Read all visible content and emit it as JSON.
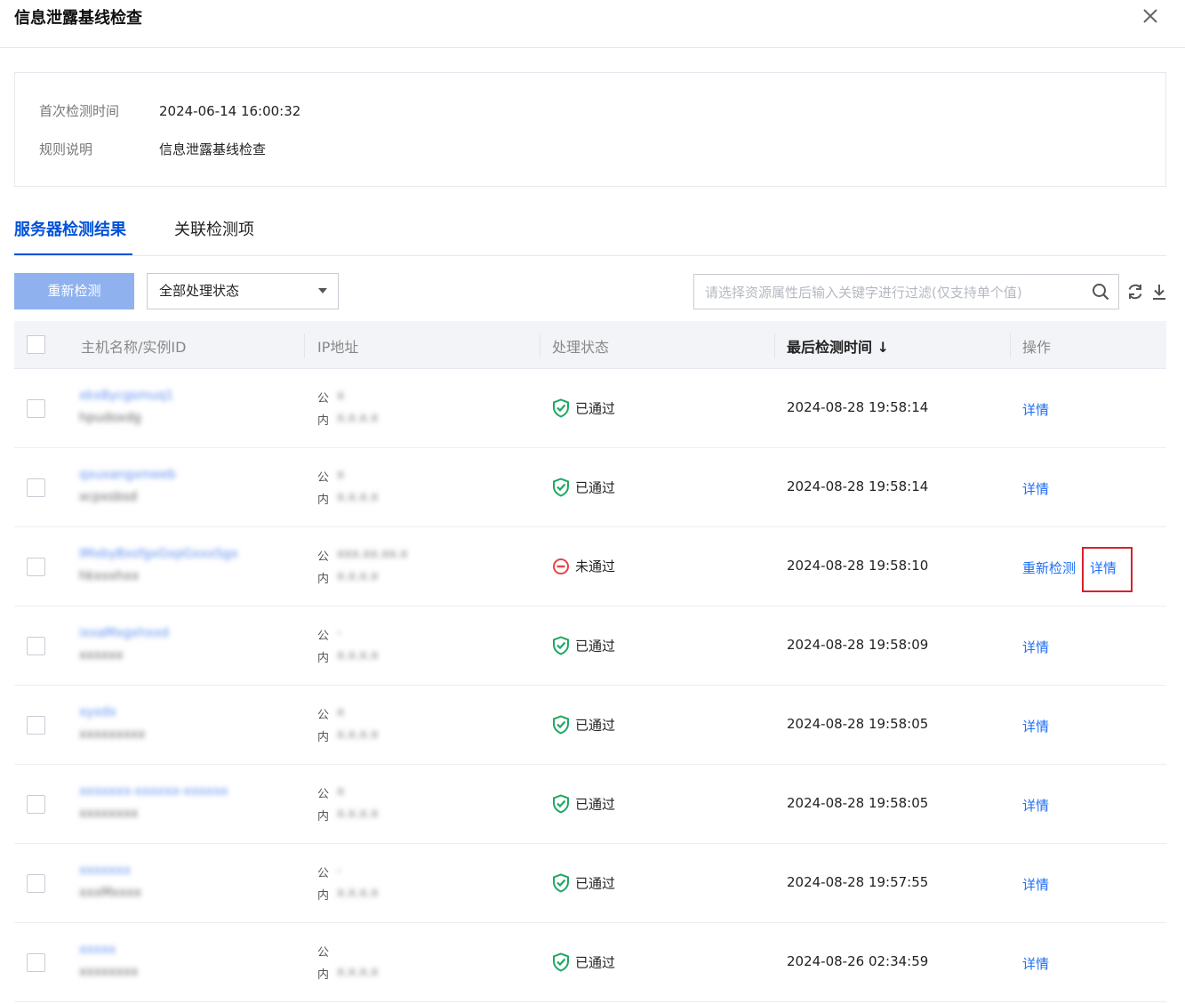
{
  "header": {
    "title": "信息泄露基线检查"
  },
  "info": {
    "first_check_label": "首次检测时间",
    "first_check_value": "2024-06-14 16:00:32",
    "rule_label": "规则说明",
    "rule_value": "信息泄露基线检查"
  },
  "tabs": [
    {
      "label": "服务器检测结果",
      "active": true
    },
    {
      "label": "关联检测项",
      "active": false
    }
  ],
  "toolbar": {
    "recheck_label": "重新检测",
    "status_select_value": "全部处理状态",
    "search_placeholder": "请选择资源属性后输入关键字进行过滤(仅支持单个值)"
  },
  "table": {
    "columns": {
      "host": "主机名称/实例ID",
      "ip": "IP地址",
      "status": "处理状态",
      "last_check": "最后检测时间",
      "sort_indicator": "↓",
      "actions": "操作"
    },
    "ip_public_label": "公",
    "ip_private_label": "内",
    "rows": [
      {
        "host_name": "xkx8ycgsmuq1",
        "instance_id": "hpudoxdg",
        "public_ip": "x",
        "private_ip": "x.x.x.x",
        "status": "已通过",
        "status_type": "pass",
        "last_check": "2024-08-28 19:58:14",
        "actions": [
          "详情"
        ]
      },
      {
        "host_name": "qxuxangxmeeb",
        "instance_id": "xcpxsbsd",
        "public_ip": "x",
        "private_ip": "x.x.x.x",
        "status": "已通过",
        "status_type": "pass",
        "last_check": "2024-08-28 19:58:14",
        "actions": [
          "详情"
        ]
      },
      {
        "host_name": "IMxbyBxsfgxGxpGxxxSgx",
        "instance_id": "hkxxxhxx",
        "public_ip": "xxx.xx.xx.x",
        "private_ip": "x.x.x.x",
        "status": "未通过",
        "status_type": "fail",
        "last_check": "2024-08-28 19:58:10",
        "actions": [
          "重新检测",
          "详情"
        ]
      },
      {
        "host_name": "ixxaMxgxhxxd",
        "instance_id": "xxxxxx",
        "public_ip": "-",
        "private_ip": "x.x.x.x",
        "status": "已通过",
        "status_type": "pass",
        "last_check": "2024-08-28 19:58:09",
        "actions": [
          "详情"
        ]
      },
      {
        "host_name": "xyxdx",
        "instance_id": "xxxxxxxxx",
        "public_ip": "x",
        "private_ip": "x.x.x.x",
        "status": "已通过",
        "status_type": "pass",
        "last_check": "2024-08-28 19:58:05",
        "actions": [
          "详情"
        ]
      },
      {
        "host_name": "xxxxxxx-xxxxxx-xxxxxx",
        "instance_id": "xxxxxxxx",
        "public_ip": "x",
        "private_ip": "x.x.x.x",
        "status": "已通过",
        "status_type": "pass",
        "last_check": "2024-08-28 19:58:05",
        "actions": [
          "详情"
        ]
      },
      {
        "host_name": "xxxxxxx",
        "instance_id": "xxxMxxxx",
        "public_ip": "-",
        "private_ip": "x.x.x.x",
        "status": "已通过",
        "status_type": "pass",
        "last_check": "2024-08-28 19:57:55",
        "actions": [
          "详情"
        ]
      },
      {
        "host_name": "xxxxx",
        "instance_id": "xxxxxxxx",
        "public_ip": "",
        "private_ip": "x.x.x.x",
        "status": "已通过",
        "status_type": "pass",
        "last_check": "2024-08-26 02:34:59",
        "actions": [
          "详情"
        ]
      }
    ]
  },
  "colors": {
    "accent": "#0052d9",
    "link": "#1f6ef5",
    "pass": "#1ea862",
    "fail": "#e54545",
    "highlight_box": "#d9202a"
  },
  "icons": {
    "close": "close-icon",
    "search": "search-icon",
    "refresh": "refresh-icon",
    "download": "download-icon",
    "pass": "shield-check-icon",
    "fail": "minus-circle-icon",
    "dropdown": "caret-down-icon"
  }
}
